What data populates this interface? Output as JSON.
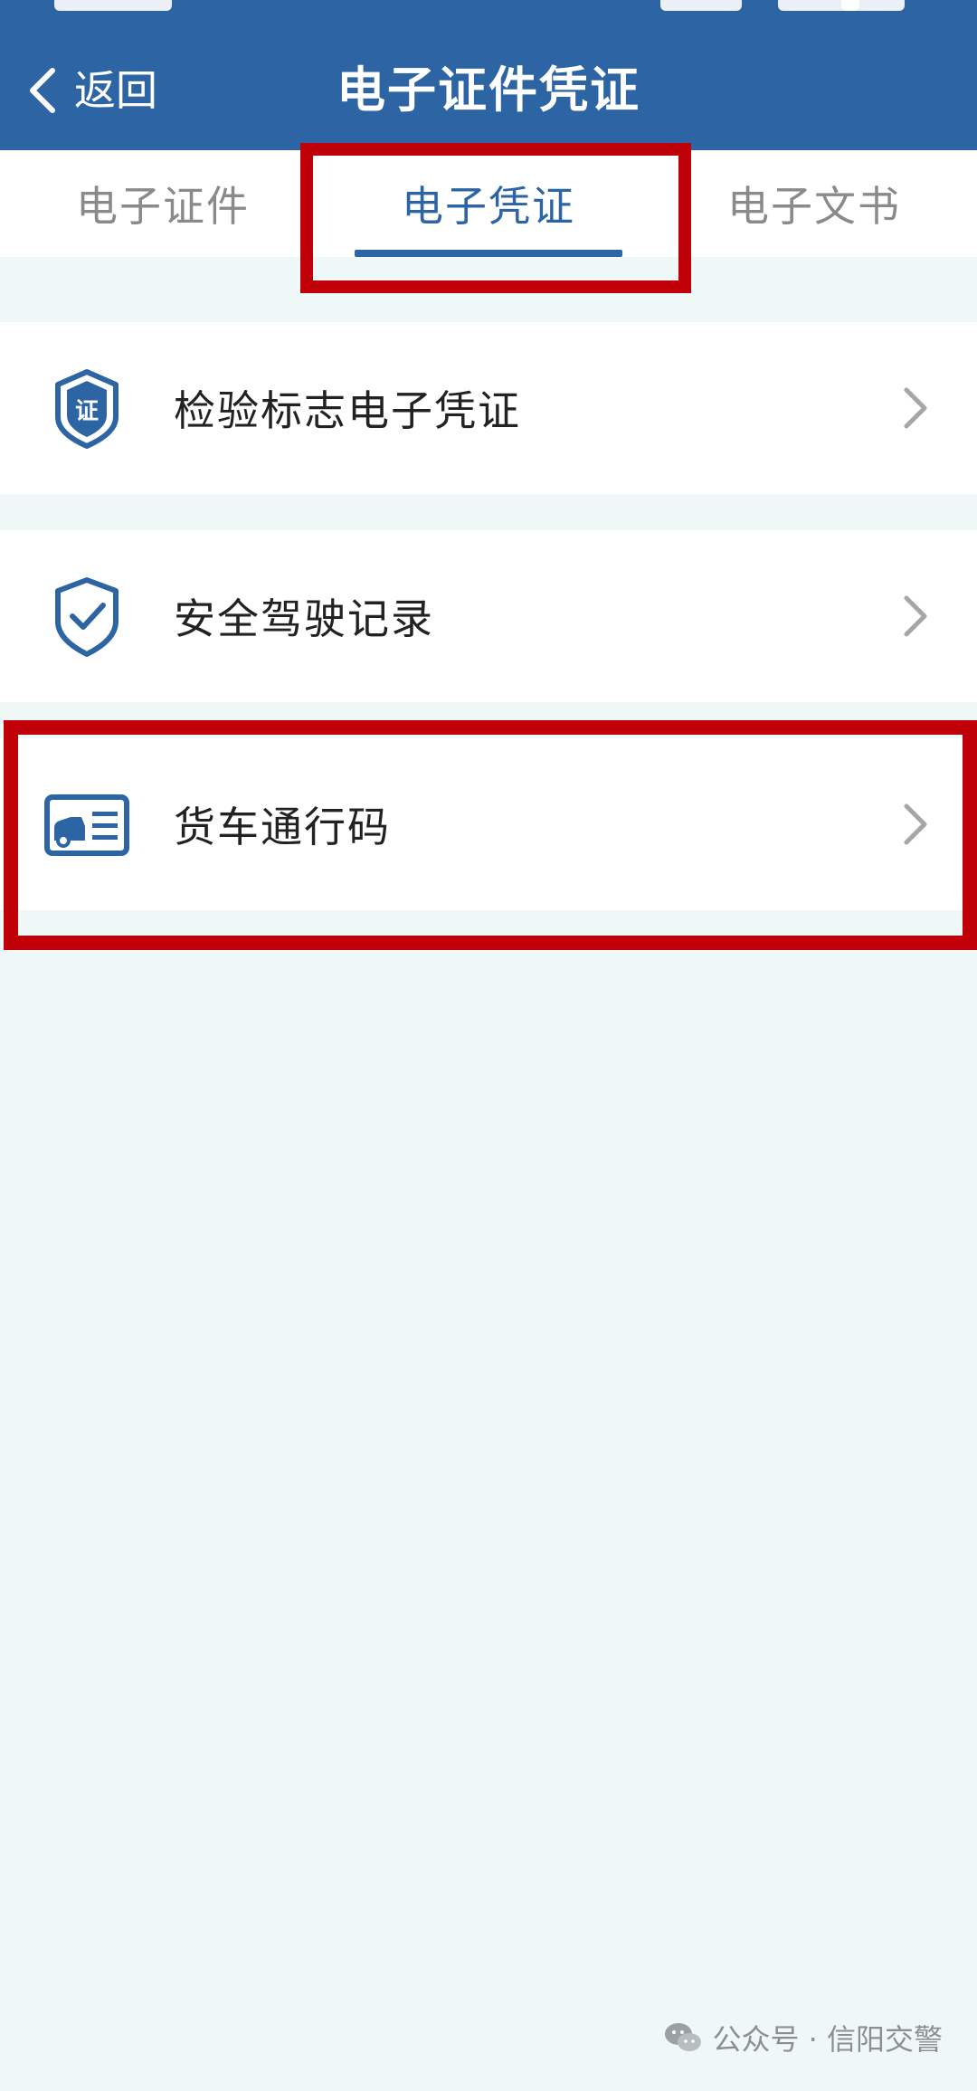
{
  "header": {
    "back_label": "返回",
    "title": "电子证件凭证"
  },
  "tabs": [
    {
      "label": "电子证件",
      "active": false
    },
    {
      "label": "电子凭证",
      "active": true
    },
    {
      "label": "电子文书",
      "active": false
    }
  ],
  "list": [
    {
      "label": "检验标志电子凭证",
      "icon": "certificate-shield-icon"
    },
    {
      "label": "安全驾驶记录",
      "icon": "shield-check-icon"
    },
    {
      "label": "货车通行码",
      "icon": "truck-card-icon"
    }
  ],
  "watermark": {
    "text": "公众号 · 信阳交警",
    "icon": "wechat-icon"
  },
  "colors": {
    "brand": "#2d65a4",
    "highlight": "#c00008",
    "background": "#f0f7f7"
  }
}
